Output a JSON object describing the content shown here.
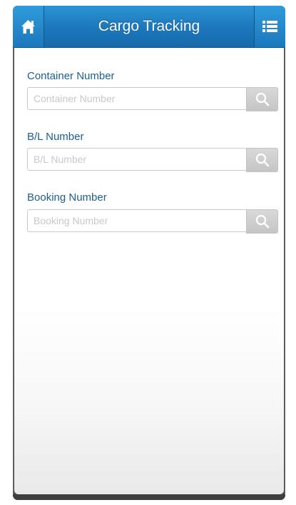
{
  "app": {
    "title": "Cargo Tracking"
  },
  "header": {
    "home_icon": "home-icon",
    "menu_icon": "list-menu-icon"
  },
  "fields": [
    {
      "label": "Container Number",
      "placeholder": "Container Number",
      "value": "",
      "button_icon": "search-icon"
    },
    {
      "label": "B/L Number",
      "placeholder": "B/L Number",
      "value": "",
      "button_icon": "search-icon"
    },
    {
      "label": "Booking Number",
      "placeholder": "Booking Number",
      "value": "",
      "button_icon": "search-icon"
    }
  ],
  "colors": {
    "header_blue": "#1d78bc",
    "label_blue": "#1b5f91",
    "button_gray": "#cfcfcf"
  }
}
